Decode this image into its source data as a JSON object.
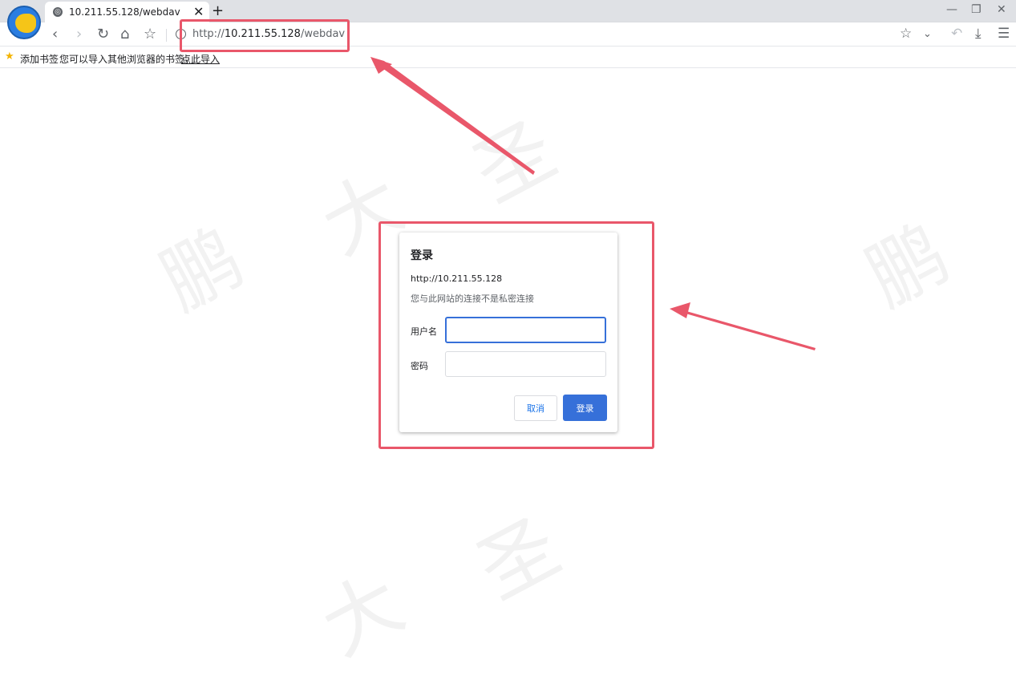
{
  "tab": {
    "title": "10.211.55.128/webdav"
  },
  "address_bar": {
    "scheme": "http://",
    "host": "10.211.55.128",
    "path": "/webdav"
  },
  "bookmarks_bar": {
    "add_label": "添加书签",
    "tip": "您可以导入其他浏览器的书签，",
    "import_link": "点此导入"
  },
  "watermark": {
    "chars": [
      "鹏",
      "大",
      "圣",
      "鹏",
      "大",
      "圣"
    ]
  },
  "dialog": {
    "title": "登录",
    "url": "http://10.211.55.128",
    "warning": "您与此网站的连接不是私密连接",
    "username_label": "用户名",
    "password_label": "密码",
    "username_value": "",
    "password_value": "",
    "cancel_label": "取消",
    "login_label": "登录"
  },
  "colors": {
    "annotation": "#e9576a",
    "primary": "#3670d9",
    "link": "#1a73e8"
  },
  "icons": [
    "browser-logo-icon",
    "globe-icon",
    "close-icon",
    "plus-icon",
    "back-icon",
    "forward-icon",
    "reload-icon",
    "home-icon",
    "star-icon",
    "info-icon",
    "bookmark-star-icon",
    "dropdown-icon",
    "undo-icon",
    "download-icon",
    "menu-icon",
    "minimize-icon",
    "restore-icon",
    "window-close-icon"
  ]
}
